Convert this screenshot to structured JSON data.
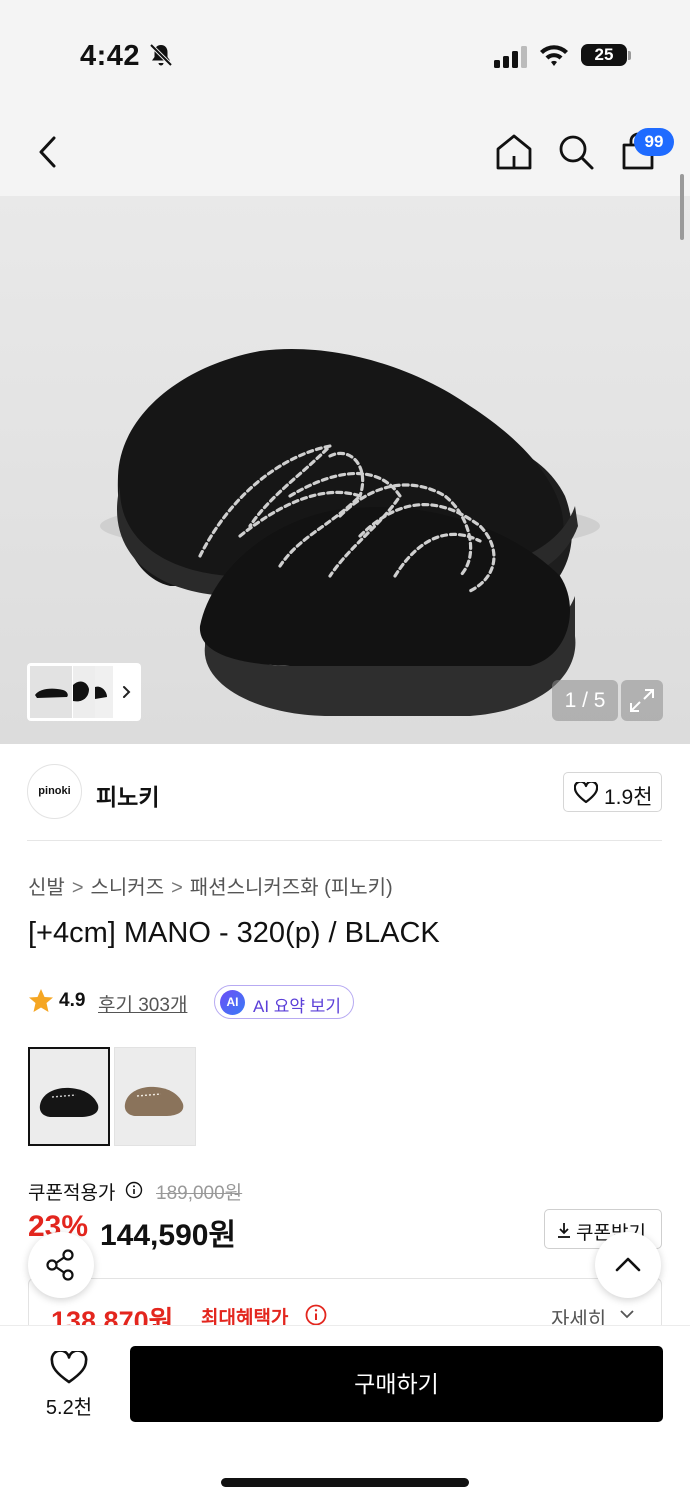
{
  "status_bar": {
    "time": "4:42",
    "battery": "25"
  },
  "nav": {
    "cart_count": "99"
  },
  "gallery": {
    "counter": "1 / 5"
  },
  "brand": {
    "logo_text": "pinoki",
    "name": "피노키",
    "like_count": "1.9천"
  },
  "breadcrumb": [
    "신발",
    "스니커즈",
    "패션스니커즈화 (피노키)"
  ],
  "product": {
    "title": "[+4cm] MANO - 320(p) / BLACK",
    "rating": "4.9",
    "reviews": "후기 303개",
    "ai_badge": "AI",
    "ai_label": "AI 요약 보기"
  },
  "price": {
    "coupon_label": "쿠폰적용가",
    "original": "189,000원",
    "discount": "23%",
    "sale": "144,590원",
    "coupon_button": "쿠폰받기",
    "max_benefit_price": "138,870원",
    "max_benefit_label": "최대혜택가",
    "details": "자세히"
  },
  "bottom_bar": {
    "wishlist_count": "5.2천",
    "buy_label": "구매하기"
  },
  "colors": {
    "accent_red": "#e3261e",
    "badge_blue": "#1f6bff",
    "ai_purple": "#5b3fd8"
  }
}
